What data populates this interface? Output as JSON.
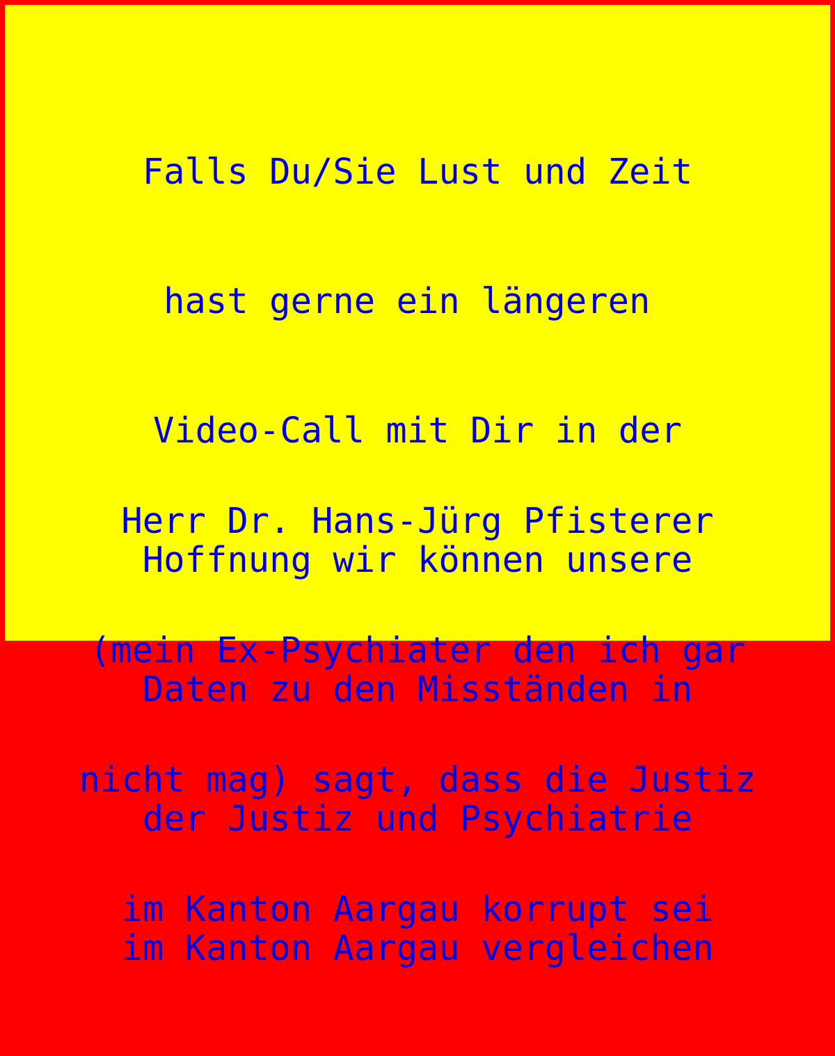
{
  "colors": {
    "background": "#ffff00",
    "border": "#ff0000",
    "text": "#0000e0"
  },
  "paragraph_1": {
    "lines": [
      "Falls Du/Sie Lust und Zeit",
      "hast gerne ein längeren ",
      "Video-Call mit Dir in der",
      "Hoffnung wir können unsere",
      "Daten zu den Misständen in",
      "der Justiz und Psychiatrie",
      "im Kanton Aargau vergleichen"
    ]
  },
  "paragraph_2": {
    "lines": [
      "Herr Dr. Hans-Jürg Pfisterer",
      "(mein Ex-Psychiater den ich gar",
      "nicht mag) sagt, dass die Justiz",
      "im Kanton Aargau korrupt sei"
    ]
  }
}
